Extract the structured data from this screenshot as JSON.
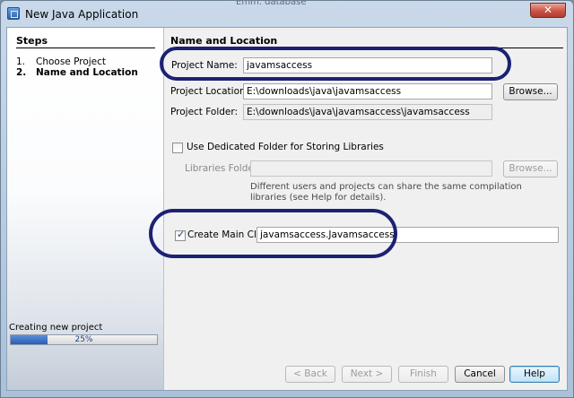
{
  "window": {
    "title": "New Java Application",
    "background_hint": "Emm. database",
    "close_glyph": "✕"
  },
  "steps": {
    "title": "Steps",
    "items": [
      {
        "num": "1.",
        "label": "Choose Project"
      },
      {
        "num": "2.",
        "label": "Name and Location",
        "current": true
      }
    ]
  },
  "progress": {
    "label": "Creating new project",
    "percent_text": "25%",
    "value": 0.25
  },
  "section": {
    "title": "Name and Location"
  },
  "form": {
    "project_name_label": "Project Name:",
    "project_name_value": "javamsaccess",
    "project_location_label": "Project Location:",
    "project_location_value": "E:\\downloads\\java\\javamsaccess",
    "browse_label": "Browse...",
    "project_folder_label": "Project Folder:",
    "project_folder_value": "E:\\downloads\\java\\javamsaccess\\javamsaccess",
    "dedicated_folder_label": "Use Dedicated Folder for Storing Libraries",
    "dedicated_folder_checked": false,
    "libraries_folder_label": "Libraries Folder:",
    "libraries_folder_value": "",
    "libraries_browse_label": "Browse...",
    "libraries_hint_line1": "Different users and projects can share the same compilation",
    "libraries_hint_line2": "libraries (see Help for details).",
    "create_main_class_label": "Create Main Class",
    "create_main_class_checked": true,
    "main_class_value": "javamsaccess.Javamsaccess"
  },
  "buttons": {
    "back": "< Back",
    "next": "Next >",
    "finish": "Finish",
    "cancel": "Cancel",
    "help": "Help"
  },
  "colors": {
    "highlight_ring": "#1c2173",
    "progress_fill": "#2a5cb3"
  }
}
